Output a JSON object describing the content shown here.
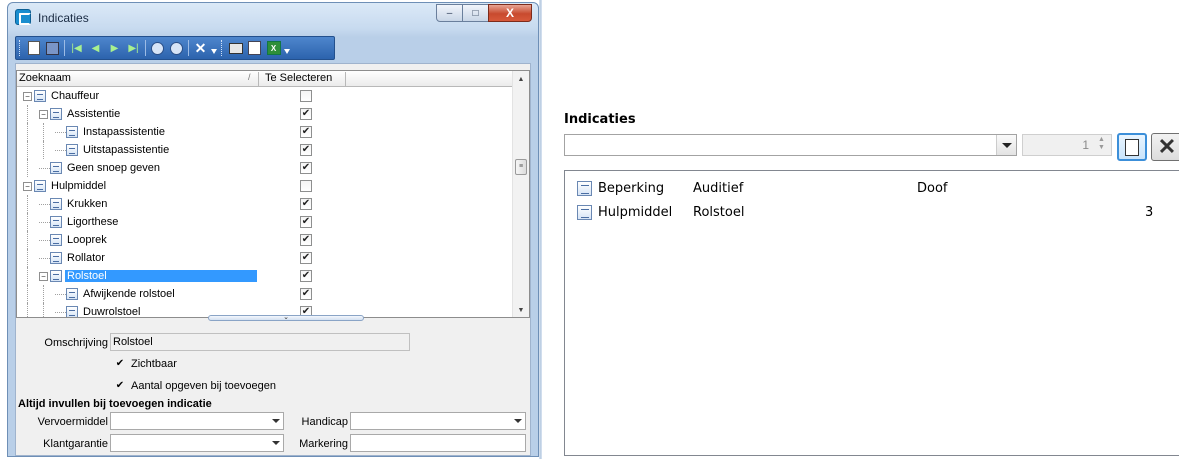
{
  "window": {
    "title": "Indicaties"
  },
  "grid": {
    "headers": {
      "name": "Zoeknaam",
      "sort": "/",
      "select": "Te Selecteren"
    },
    "rows": [
      {
        "label": "Chauffeur",
        "level": 0,
        "expand": "−",
        "checked": false
      },
      {
        "label": "Assistentie",
        "level": 1,
        "expand": "−",
        "checked": true
      },
      {
        "label": "Instapassistentie",
        "level": 2,
        "expand": "",
        "checked": true
      },
      {
        "label": "Uitstapassistentie",
        "level": 2,
        "expand": "",
        "checked": true
      },
      {
        "label": "Geen snoep geven",
        "level": 1,
        "expand": "",
        "checked": true
      },
      {
        "label": "Hulpmiddel",
        "level": 0,
        "expand": "−",
        "checked": false
      },
      {
        "label": "Krukken",
        "level": 1,
        "expand": "",
        "checked": true
      },
      {
        "label": "Ligorthese",
        "level": 1,
        "expand": "",
        "checked": true
      },
      {
        "label": "Looprek",
        "level": 1,
        "expand": "",
        "checked": true
      },
      {
        "label": "Rollator",
        "level": 1,
        "expand": "",
        "checked": true
      },
      {
        "label": "Rolstoel",
        "level": 1,
        "expand": "−",
        "checked": true,
        "selected": true
      },
      {
        "label": "Afwijkende rolstoel",
        "level": 2,
        "expand": "",
        "checked": true
      },
      {
        "label": "Duwrolstoel",
        "level": 2,
        "expand": "",
        "checked": true
      }
    ]
  },
  "form": {
    "omschrijving_label": "Omschrijving",
    "omschrijving_value": "Rolstoel",
    "zichtbaar_label": "Zichtbaar",
    "aantal_label": "Aantal opgeven bij toevoegen",
    "section_title": "Altijd invullen bij toevoegen indicatie",
    "vervoermiddel_label": "Vervoermiddel",
    "handicap_label": "Handicap",
    "klantgarantie_label": "Klantgarantie",
    "markering_label": "Markering"
  },
  "right": {
    "title": "Indicaties",
    "spin_value": "1",
    "items": [
      {
        "c1": "Beperking",
        "c2": "Auditief",
        "c3": "Doof",
        "c4": ""
      },
      {
        "c1": "Hulpmiddel",
        "c2": "Rolstoel",
        "c3": "",
        "c4": "3"
      }
    ]
  },
  "glyphs": {
    "check": "✔",
    "minimize": "–",
    "maximize": "□",
    "close": "X",
    "up": "▲",
    "down": "▼",
    "delete": "✕"
  }
}
